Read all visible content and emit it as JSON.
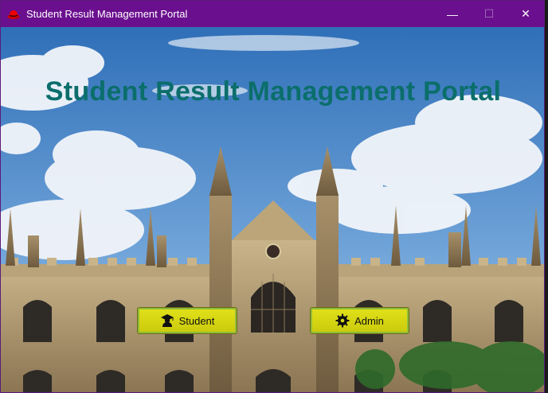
{
  "window": {
    "title": "Student Result Management Portal",
    "controls": {
      "minimize": "—",
      "maximize": "☐",
      "close": "✕"
    }
  },
  "main": {
    "heading": "Student Result Management Portal",
    "buttons": [
      {
        "label": "Student",
        "icon": "graduate-icon"
      },
      {
        "label": "Admin",
        "icon": "gear-icon"
      }
    ]
  },
  "colors": {
    "titlebar": "#6a0f8e",
    "heading": "#0b6e6b",
    "button": "#d8d816"
  }
}
